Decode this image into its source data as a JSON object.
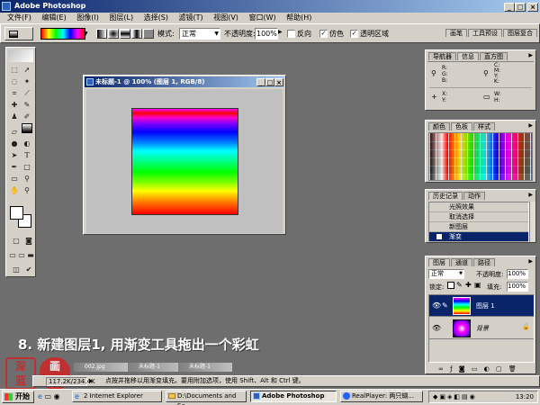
{
  "window": {
    "title": "Adobe Photoshop",
    "controls": [
      "_",
      "□",
      "×"
    ]
  },
  "menu": [
    "文件(F)",
    "编辑(E)",
    "图像(I)",
    "图层(L)",
    "选择(S)",
    "滤镜(T)",
    "视图(V)",
    "窗口(W)",
    "帮助(H)"
  ],
  "options_bar": {
    "mode_label": "模式:",
    "mode_value": "正常",
    "opacity_label": "不透明度:",
    "opacity_value": "100%",
    "reverse_label": "反向",
    "dither_label": "仿色",
    "transparency_label": "透明区域",
    "dither_checked": true,
    "transparency_checked": true,
    "reverse_checked": false,
    "palette_well_tabs": [
      "画笔",
      "工具预设",
      "图层复合"
    ]
  },
  "document": {
    "title": "未标题-1 @ 100% (图层 1, RGB/8)"
  },
  "info_panel": {
    "tabs": [
      "导航器",
      "信息",
      "直方图"
    ],
    "rgb": [
      "R:",
      "G:",
      "B:"
    ],
    "cmyk": [
      "C:",
      "M:",
      "Y:",
      "K:"
    ],
    "xy": [
      "X:",
      "Y:"
    ],
    "wh": [
      "W:",
      "H:"
    ]
  },
  "swatches_panel": {
    "tabs": [
      "颜色",
      "色板",
      "样式"
    ]
  },
  "history_panel": {
    "tabs": [
      "历史记录",
      "动作"
    ],
    "items": [
      "光照效果",
      "取消选择",
      "新图层",
      "渐变"
    ]
  },
  "layers_panel": {
    "tabs": [
      "图层",
      "通道",
      "路径"
    ],
    "blend_mode": "正常",
    "opacity_label": "不透明度:",
    "opacity_value": "100%",
    "lock_label": "锁定:",
    "fill_label": "填充:",
    "fill_value": "100%",
    "layers": [
      {
        "name": "图层 1",
        "selected": true
      },
      {
        "name": "背景",
        "selected": false
      }
    ]
  },
  "status_bar": {
    "doc_size": "117.2K/234.4K",
    "hint": "点按并拖移以用渐变填充。要用附加选项，使用 Shift、Alt 和 Ctrl 键。"
  },
  "minimized_docs": [
    "002.jpg",
    "未标题-1",
    "未标题-1"
  ],
  "caption": "8. 新建图层1, 用渐变工具拖出一个彩虹",
  "seal_text": "深蓝画图",
  "taskbar": {
    "start": "开始",
    "items": [
      "2 Internet Explorer",
      "D:\\Documents and Se...",
      "Adobe Photoshop",
      "RealPlayer: 两只蝴..."
    ],
    "time": "13:20"
  },
  "colors": {
    "titlebar_start": "#0a246a",
    "titlebar_end": "#a6caf0",
    "workspace": "#6e6e6e",
    "selection": "#0a246a",
    "chrome": "#d4d0c8",
    "caption": "#ffffff"
  },
  "icons": [
    "ps-app-icon",
    "marquee-icon",
    "move-icon",
    "lasso-icon",
    "magic-wand-icon",
    "crop-icon",
    "slice-icon",
    "healing-icon",
    "brush-icon",
    "stamp-icon",
    "history-brush-icon",
    "eraser-icon",
    "gradient-icon",
    "blur-icon",
    "dodge-icon",
    "path-select-icon",
    "type-icon",
    "pen-icon",
    "shape-icon",
    "notes-icon",
    "eyedropper-icon",
    "hand-icon",
    "zoom-icon",
    "eye-icon",
    "link-icon",
    "trash-icon",
    "new-layer-icon"
  ]
}
